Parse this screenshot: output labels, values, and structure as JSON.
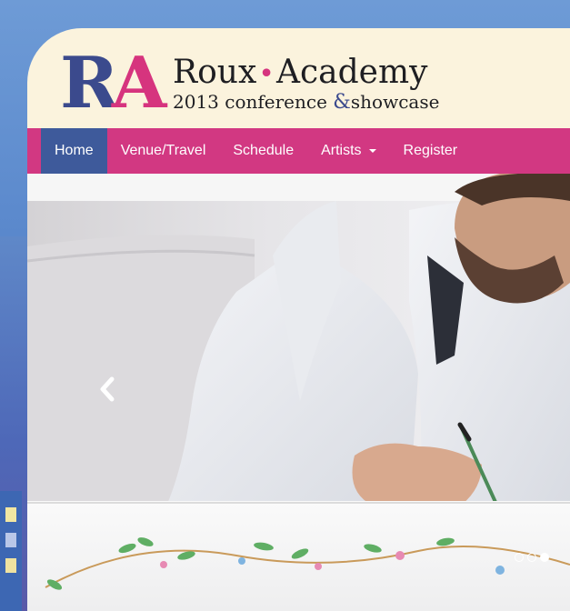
{
  "logo": {
    "monogram_r": "R",
    "monogram_a": "A",
    "name_part1": "Roux",
    "name_sep": "•",
    "name_part2": "Academy",
    "sub_year": "2013 conference",
    "sub_amp": "&",
    "sub_rest": "showcase"
  },
  "nav": {
    "items": [
      {
        "label": "Home",
        "active": true
      },
      {
        "label": "Venue/Travel",
        "active": false
      },
      {
        "label": "Schedule",
        "active": false
      },
      {
        "label": "Artists",
        "active": false,
        "dropdown": true
      },
      {
        "label": "Register",
        "active": false
      }
    ]
  },
  "carousel": {
    "slide_count": 3,
    "active_slide": 3,
    "prev_control": "chevron-left-icon"
  },
  "colors": {
    "brand_pink": "#d23882",
    "brand_navy": "#3b4a8d",
    "active_nav": "#3e5a9b",
    "card_cream": "#fbf3dd",
    "page_blue": "#5a88cc"
  }
}
